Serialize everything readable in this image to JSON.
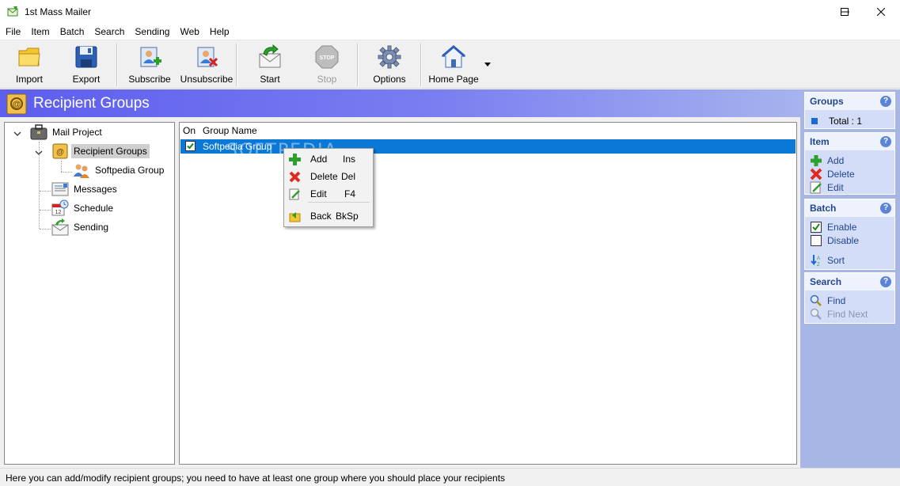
{
  "window": {
    "title": "1st Mass Mailer"
  },
  "menu": [
    "File",
    "Item",
    "Batch",
    "Search",
    "Sending",
    "Web",
    "Help"
  ],
  "toolbar": {
    "import": "Import",
    "export": "Export",
    "subscribe": "Subscribe",
    "unsubscribe": "Unsubscribe",
    "start": "Start",
    "stop": "Stop",
    "options": "Options",
    "home_page": "Home Page"
  },
  "header": {
    "title": "Recipient Groups"
  },
  "tree": {
    "root": "Mail Project",
    "recipient_groups": "Recipient Groups",
    "softpedia_group": "Softpedia Group",
    "messages": "Messages",
    "schedule": "Schedule",
    "sending": "Sending"
  },
  "list": {
    "columns": [
      "On",
      "Group Name"
    ],
    "rows": [
      {
        "on": true,
        "name": "Softpedia Group"
      }
    ]
  },
  "watermark": "SOFTPEDIA",
  "context_menu": {
    "items": [
      {
        "label": "Add",
        "shortcut": "Ins"
      },
      {
        "label": "Delete",
        "shortcut": "Del"
      },
      {
        "label": "Edit",
        "shortcut": "F4"
      },
      {
        "label": "Back",
        "shortcut": "BkSp"
      }
    ]
  },
  "tasks": {
    "groups": {
      "title": "Groups",
      "help": "?",
      "total": "Total : 1"
    },
    "item": {
      "title": "Item",
      "help": "?",
      "add": "Add",
      "delete": "Delete",
      "edit": "Edit"
    },
    "batch": {
      "title": "Batch",
      "help": "?",
      "enable": "Enable",
      "disable": "Disable",
      "sort": "Sort"
    },
    "search": {
      "title": "Search",
      "help": "?",
      "find": "Find",
      "find_next": "Find Next"
    }
  },
  "status": "Here you can add/modify recipient groups; you need to have at least one group where you should place your recipients",
  "colors": {
    "selection": "#0a78d7",
    "header_start": "#5d5dee",
    "task_pane": "#a8b6e6",
    "link": "#21468f"
  }
}
